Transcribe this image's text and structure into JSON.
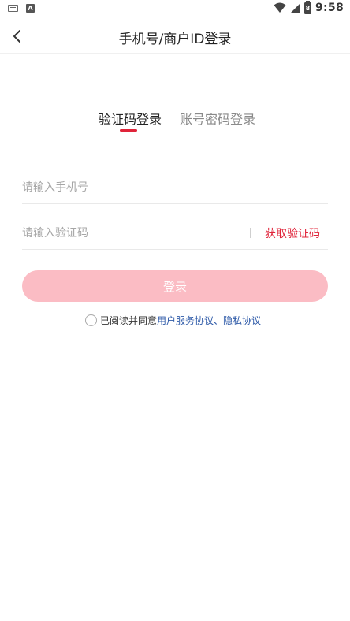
{
  "status_bar": {
    "time": "9:58",
    "battery_level": "8",
    "left_icons": [
      "keyboard-icon",
      "a-icon"
    ],
    "right_icons": [
      "wifi-icon",
      "signal-icon",
      "battery-icon"
    ]
  },
  "nav": {
    "title": "手机号/商户ID登录",
    "back_icon": "chevron-left-icon"
  },
  "tabs": [
    {
      "label": "验证码登录",
      "active": true
    },
    {
      "label": "账号密码登录",
      "active": false
    }
  ],
  "form": {
    "phone_placeholder": "请输入手机号",
    "phone_value": "",
    "code_placeholder": "请输入验证码",
    "code_value": "",
    "get_code_label": "获取验证码"
  },
  "login_button": {
    "label": "登录"
  },
  "agreement": {
    "prefix": "已阅读并同意",
    "user_agreement": "用户服务协议",
    "separator": "、",
    "privacy_agreement": "隐私协议",
    "checked": false
  },
  "colors": {
    "accent": "#e0243a",
    "button_disabled": "#fbbcc4",
    "link": "#2e5aa8",
    "placeholder": "#a6a6a6"
  }
}
